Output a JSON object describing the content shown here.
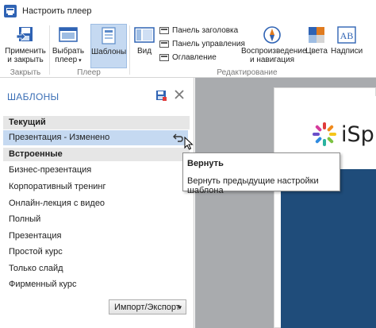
{
  "window": {
    "title": "Настроить плеер"
  },
  "ribbon": {
    "apply_close": "Применить\nи закрыть",
    "apply_close_l1": "Применить",
    "apply_close_l2": "и закрыть",
    "choose_player_l1": "Выбрать",
    "choose_player_l2": "плеер",
    "templates": "Шаблоны",
    "view": "Вид",
    "options": [
      {
        "label": "Панель заголовка"
      },
      {
        "label": "Панель управления"
      },
      {
        "label": "Оглавление"
      }
    ],
    "playback_l1": "Воспроизведение",
    "playback_l2": "и навигация",
    "colors": "Цвета",
    "labels": "Надписи",
    "group_close": "Закрыть",
    "group_player": "Плеер",
    "group_edit": "Редактирование"
  },
  "panel": {
    "title": "ШАБЛОНЫ",
    "section_current": "Текущий",
    "current_item": "Презентация - Изменено",
    "section_builtin": "Встроенные",
    "builtin_items": [
      "Бизнес-презентация",
      "Корпоративный тренинг",
      "Онлайн-лекция с видео",
      "Полный",
      "Презентация",
      "Простой курс",
      "Только слайд",
      "Фирменный курс"
    ],
    "import_export": "Импорт/Экспорт"
  },
  "tooltip": {
    "title": "Вернуть",
    "description": "Вернуть предыдущие настройки шаблона"
  },
  "preview": {
    "logo_text": "iSpri"
  },
  "colors": {
    "accent_blue": "#3b6fb6",
    "selected_bg": "#c5d9f1",
    "slide_dark": "#1f4c7a",
    "preview_bg": "#a9abae"
  }
}
